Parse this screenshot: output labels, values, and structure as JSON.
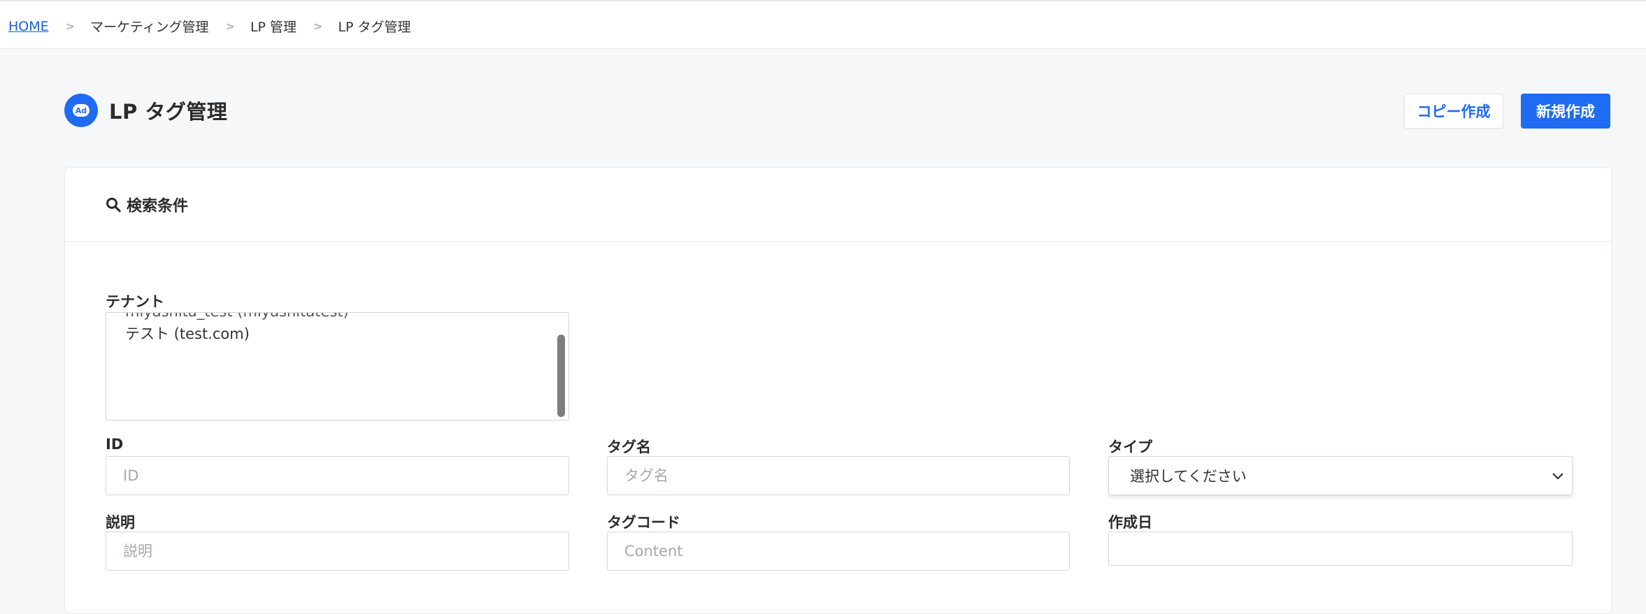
{
  "breadcrumb": {
    "home": "HOME",
    "sep": ">",
    "items": [
      "マーケティング管理",
      "LP 管理",
      "LP タグ管理"
    ]
  },
  "page": {
    "title": "LP タグ管理",
    "icon_label": "Ad",
    "copy_button": "コピー作成",
    "new_button": "新規作成"
  },
  "search": {
    "title": "検索条件",
    "tenant": {
      "label": "テナント",
      "options": [
        "miyashita_test (miyashitatest)",
        "テスト (test.com)"
      ]
    },
    "id": {
      "label": "ID",
      "placeholder": "ID",
      "value": ""
    },
    "tag_name": {
      "label": "タグ名",
      "placeholder": "タグ名",
      "value": ""
    },
    "type": {
      "label": "タイプ",
      "selected": "選択してください"
    },
    "description": {
      "label": "説明",
      "placeholder": "説明",
      "value": ""
    },
    "tag_code": {
      "label": "タグコード",
      "placeholder": "Content",
      "value": ""
    },
    "created": {
      "label": "作成日",
      "value": ""
    }
  },
  "colors": {
    "accent": "#1f6bf2",
    "link": "#1a5fd6",
    "background": "#f6f7f9"
  }
}
